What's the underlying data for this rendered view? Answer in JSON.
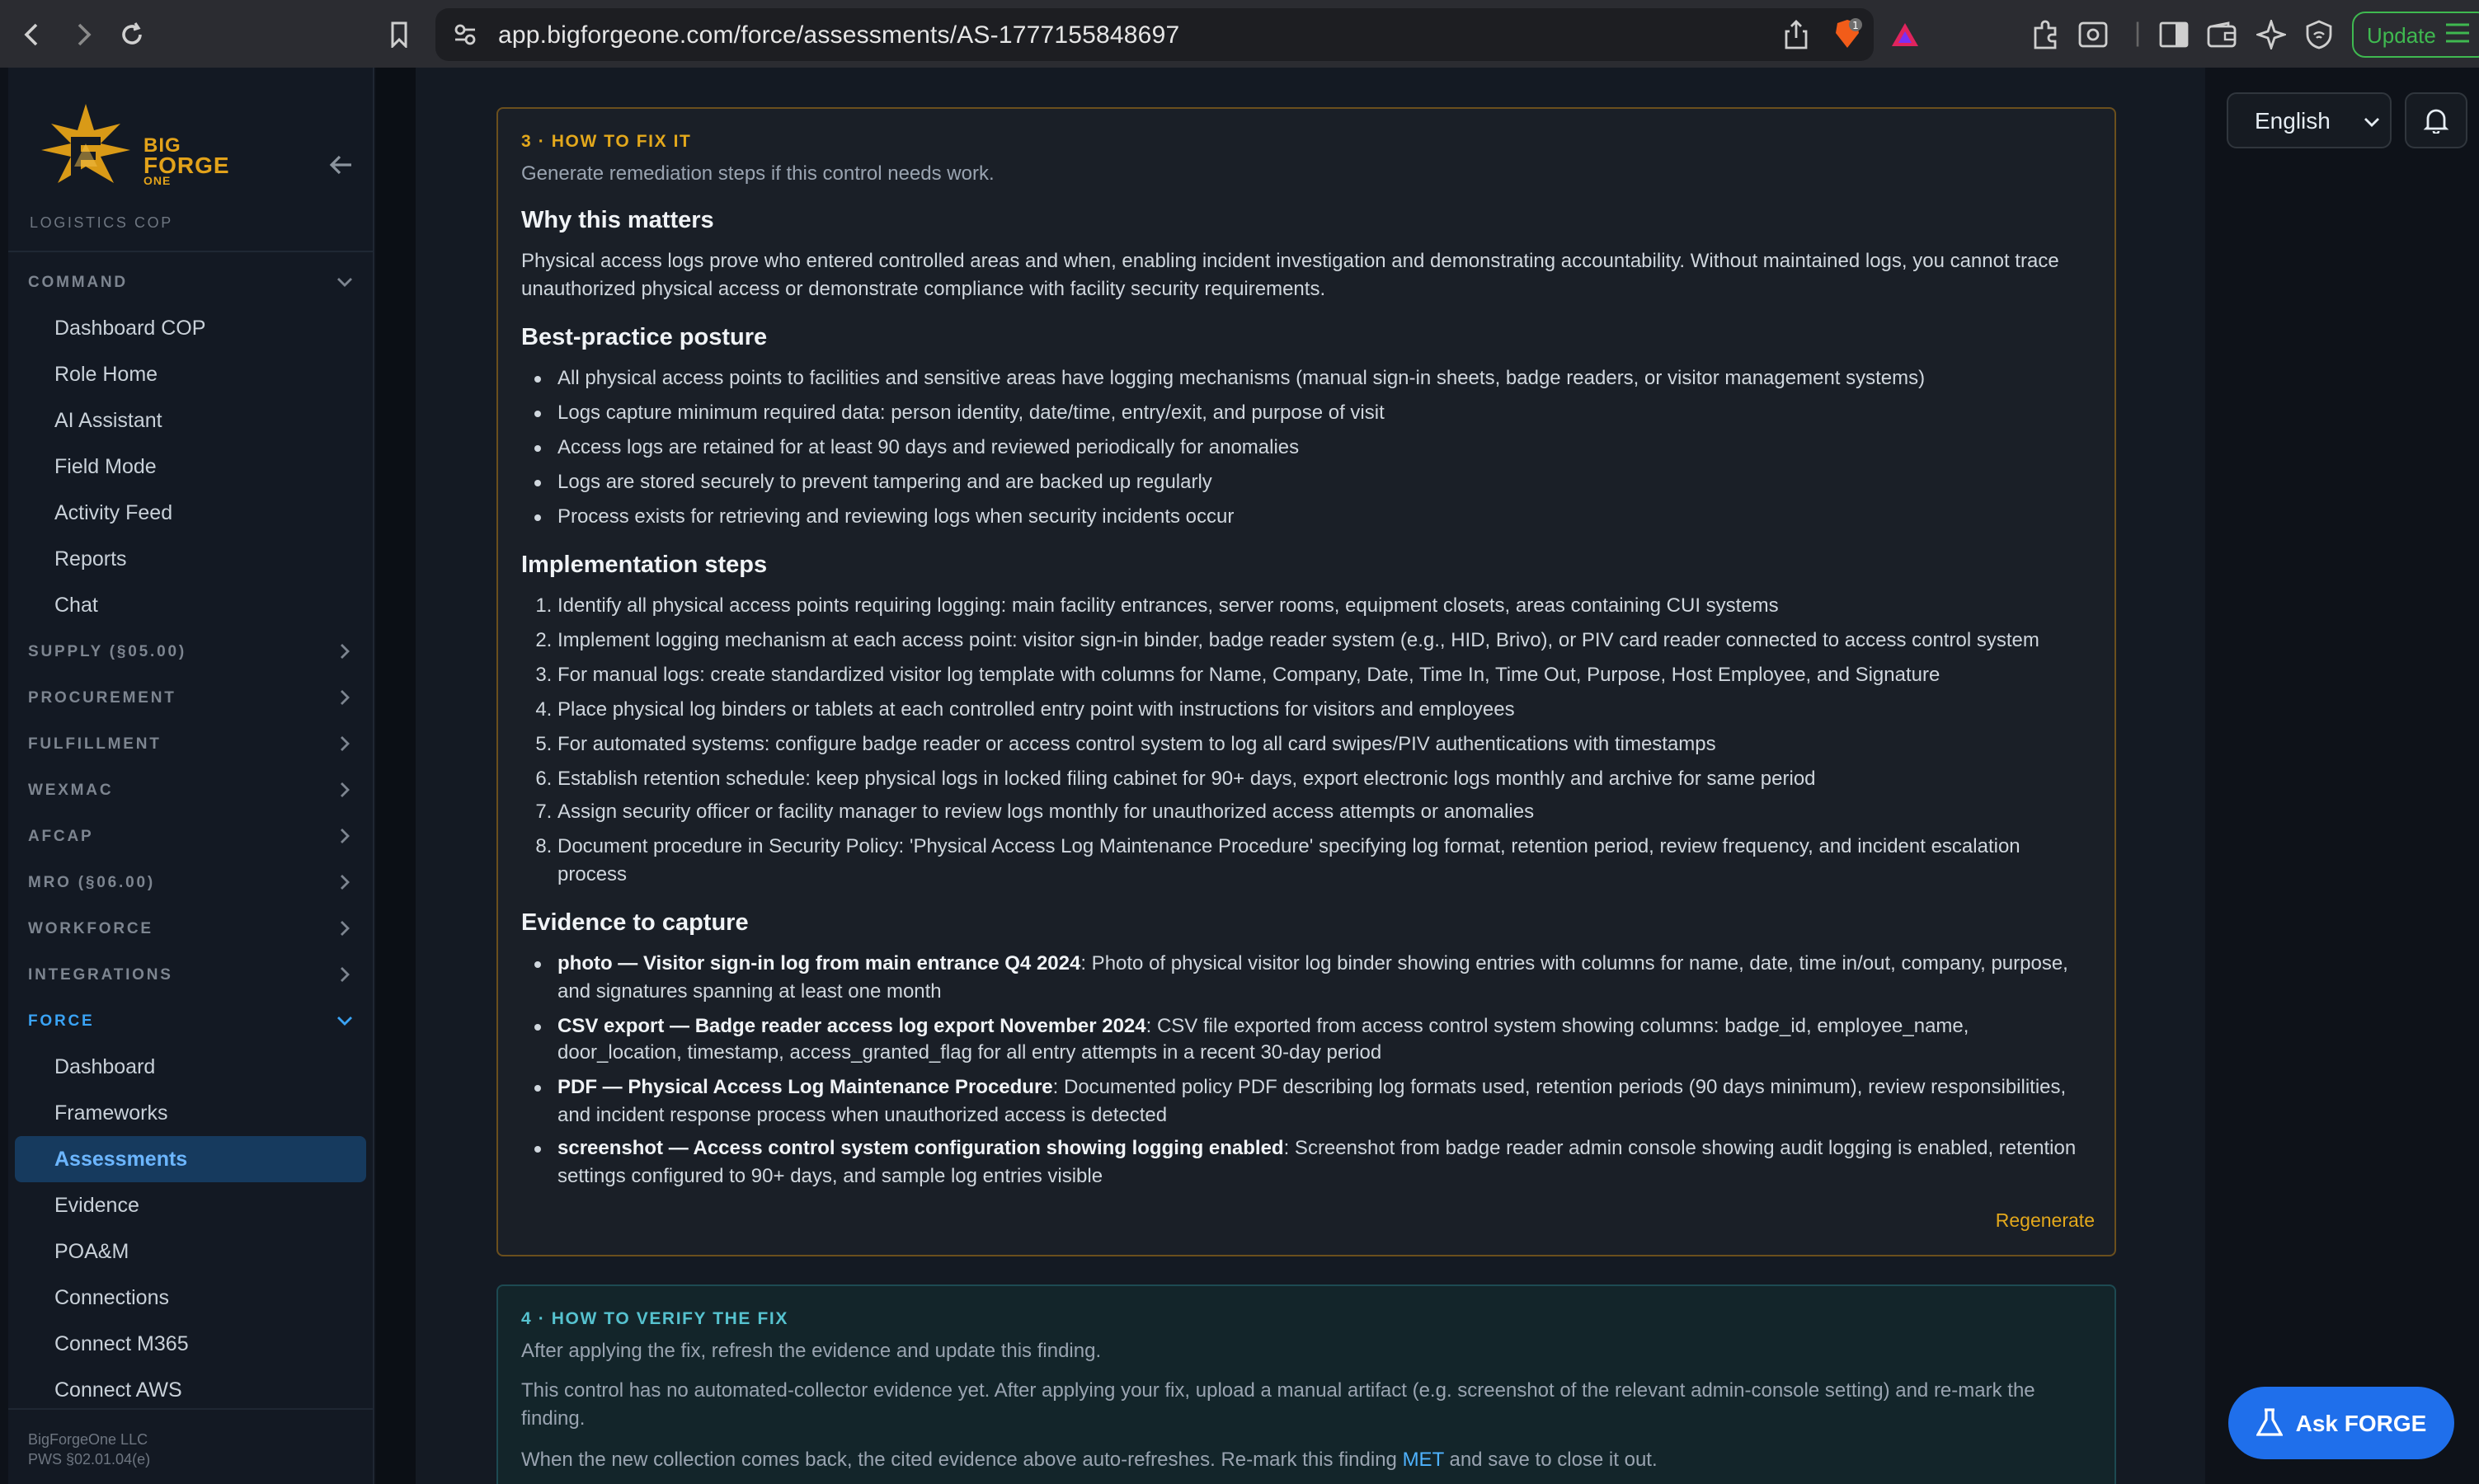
{
  "browser": {
    "url": "app.bigforgeone.com/force/assessments/AS-1777155848697",
    "update_label": "Update",
    "shield_badge": "1"
  },
  "brand": {
    "word1": "BIG",
    "word2": "FORGE",
    "word3": "ONE",
    "subtitle": "LOGISTICS COP"
  },
  "sidebar": {
    "command_label": "COMMAND",
    "command_items": [
      "Dashboard COP",
      "Role Home",
      "AI Assistant",
      "Field Mode",
      "Activity Feed",
      "Reports",
      "Chat"
    ],
    "sections": [
      "SUPPLY (§05.00)",
      "PROCUREMENT",
      "FULFILLMENT",
      "WEXMAC",
      "AFCAP",
      "MRO (§06.00)",
      "WORKFORCE",
      "INTEGRATIONS"
    ],
    "force_label": "FORCE",
    "force_items": [
      "Dashboard",
      "Frameworks",
      "Assessments",
      "Evidence",
      "POA&M",
      "Connections",
      "Connect M365",
      "Connect AWS"
    ],
    "footer_line1": "BigForgeOne LLC",
    "footer_line2": "PWS §02.01.04(e)"
  },
  "topright": {
    "language": "English"
  },
  "fix_card": {
    "kicker": "3 · HOW TO FIX IT",
    "subtitle": "Generate remediation steps if this control needs work.",
    "why_heading": "Why this matters",
    "why_text": "Physical access logs prove who entered controlled areas and when, enabling incident investigation and demonstrating accountability. Without maintained logs, you cannot trace unauthorized physical access or demonstrate compliance with facility security requirements.",
    "best_heading": "Best-practice posture",
    "best_items": [
      "All physical access points to facilities and sensitive areas have logging mechanisms (manual sign-in sheets, badge readers, or visitor management systems)",
      "Logs capture minimum required data: person identity, date/time, entry/exit, and purpose of visit",
      "Access logs are retained for at least 90 days and reviewed periodically for anomalies",
      "Logs are stored securely to prevent tampering and are backed up regularly",
      "Process exists for retrieving and reviewing logs when security incidents occur"
    ],
    "impl_heading": "Implementation steps",
    "impl_items": [
      "Identify all physical access points requiring logging: main facility entrances, server rooms, equipment closets, areas containing CUI systems",
      "Implement logging mechanism at each access point: visitor sign-in binder, badge reader system (e.g., HID, Brivo), or PIV card reader connected to access control system",
      "For manual logs: create standardized visitor log template with columns for Name, Company, Date, Time In, Time Out, Purpose, Host Employee, and Signature",
      "Place physical log binders or tablets at each controlled entry point with instructions for visitors and employees",
      "For automated systems: configure badge reader or access control system to log all card swipes/PIV authentications with timestamps",
      "Establish retention schedule: keep physical logs in locked filing cabinet for 90+ days, export electronic logs monthly and archive for same period",
      "Assign security officer or facility manager to review logs monthly for unauthorized access attempts or anomalies",
      "Document procedure in Security Policy: 'Physical Access Log Maintenance Procedure' specifying log format, retention period, review frequency, and incident escalation process"
    ],
    "evidence_heading": "Evidence to capture",
    "evidence_items": [
      {
        "title": "photo — Visitor sign-in log from main entrance Q4 2024",
        "desc": ": Photo of physical visitor log binder showing entries with columns for name, date, time in/out, company, purpose, and signatures spanning at least one month"
      },
      {
        "title": "CSV export — Badge reader access log export November 2024",
        "desc": ": CSV file exported from access control system showing columns: badge_id, employee_name, door_location, timestamp, access_granted_flag for all entry attempts in a recent 30-day period"
      },
      {
        "title": "PDF — Physical Access Log Maintenance Procedure",
        "desc": ": Documented policy PDF describing log formats used, retention periods (90 days minimum), review responsibilities, and incident response process when unauthorized access is detected"
      },
      {
        "title": "screenshot — Access control system configuration showing logging enabled",
        "desc": ": Screenshot from badge reader admin console showing audit logging is enabled, retention settings configured to 90+ days, and sample log entries visible"
      }
    ],
    "regenerate_label": "Regenerate"
  },
  "verify_card": {
    "kicker": "4 · HOW TO VERIFY THE FIX",
    "subtitle": "After applying the fix, refresh the evidence and update this finding.",
    "text1": "This control has no automated-collector evidence yet. After applying your fix, upload a manual artifact (e.g. screenshot of the relevant admin-console setting) and re-mark the finding.",
    "text2_pre": "When the new collection comes back, the cited evidence above auto-refreshes. Re-mark this finding ",
    "text2_link": "MET",
    "text2_post": " and save to close it out."
  },
  "ask_label": "Ask FORGE",
  "colors": {
    "accent_gold": "#e3a81c",
    "accent_teal": "#56c2cf",
    "primary_blue": "#1f6feb",
    "active_nav": "#163a5e"
  }
}
